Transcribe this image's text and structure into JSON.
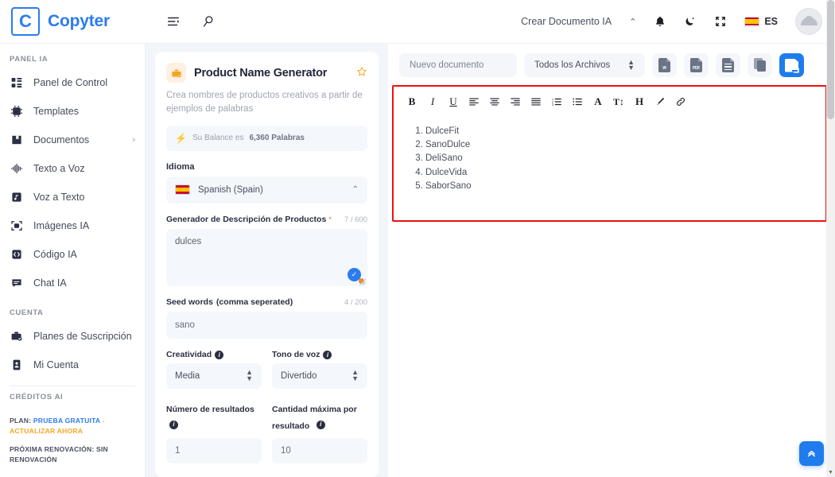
{
  "brand": {
    "logo_letter": "C",
    "name": "Copyter"
  },
  "topbar": {
    "menu_icon": "list-settings-icon",
    "search_icon": "search-icon",
    "create_doc_label": "Crear Documento IA",
    "chevron": "⌃",
    "bell_icon": "bell-icon",
    "theme_icon": "moon-icon",
    "fullscreen_icon": "compress-icon",
    "lang_code": "ES",
    "avatar_icon": "user-avatar"
  },
  "sidebar": {
    "section_panel_label": "PANEL IA",
    "items": [
      {
        "label": "Panel de Control",
        "icon": "dashboard-icon"
      },
      {
        "label": "Templates",
        "icon": "ai-chip-icon"
      },
      {
        "label": "Documentos",
        "icon": "documents-icon",
        "chevron": "›"
      },
      {
        "label": "Texto a Voz",
        "icon": "waveform-icon"
      },
      {
        "label": "Voz a Texto",
        "icon": "audio-file-icon"
      },
      {
        "label": "Imágenes IA",
        "icon": "image-capture-icon"
      },
      {
        "label": "Código IA",
        "icon": "code-icon"
      },
      {
        "label": "Chat IA",
        "icon": "chat-icon"
      }
    ],
    "section_account_label": "CUENTA",
    "account_items": [
      {
        "label": "Planes de Suscripción",
        "icon": "subscription-icon"
      },
      {
        "label": "Mi Cuenta",
        "icon": "account-card-icon"
      }
    ],
    "section_credits_label": "CRÉDITOS AI",
    "plan_prefix": "PLAN:",
    "plan_value": "PRUEBA GRATUITA",
    "plan_dash": "-",
    "plan_upgrade": "ACTUALIZAR AHORA",
    "renewal_text": "PRÓXIMA RENOVACIÓN: SIN RENOVACIÓN"
  },
  "form": {
    "template_icon": "toolbox-icon",
    "title": "Product Name Generator",
    "star_icon": "star-icon",
    "description": "Crea nombres de productos creativos a partir de ejemplos de palabras",
    "balance_icon": "bolt-icon",
    "balance_prefix": "Su Balance es",
    "balance_value": "6,360 Palabras",
    "language_label": "Idioma",
    "language_value": "Spanish (Spain)",
    "language_chevron": "⌃",
    "prompt_label": "Generador de Descripción de Productos",
    "prompt_required": "*",
    "prompt_counter": "7 / 600",
    "prompt_value": "dulces",
    "grammar_icon": "grammarly-check-icon",
    "seed_label": "Seed words",
    "seed_label_muted": "(comma seperated)",
    "seed_counter": "4 / 200",
    "seed_value": "sano",
    "creativity_label": "Creatividad",
    "creativity_value": "Media",
    "tone_label": "Tono de voz",
    "tone_value": "Divertido",
    "results_label": "Número de resultados",
    "results_value": "1",
    "maxlen_label": "Cantidad máxima por resultado",
    "maxlen_value": "10",
    "info_icon": "info-icon"
  },
  "editor": {
    "doc_name_placeholder": "Nuevo documento",
    "filter_value": "Todos los Archivos",
    "export_buttons": [
      {
        "icon": "word-export-icon",
        "tag": "W"
      },
      {
        "icon": "pdf-export-icon",
        "tag": "PDF"
      },
      {
        "icon": "text-export-icon",
        "tag": ""
      },
      {
        "icon": "copy-icon",
        "tag": ""
      },
      {
        "icon": "save-document-icon",
        "tag": ""
      }
    ],
    "format_buttons": [
      {
        "icon": "bold-icon",
        "glyph": "B"
      },
      {
        "icon": "italic-icon",
        "glyph": "I"
      },
      {
        "icon": "underline-icon",
        "glyph": "U"
      },
      {
        "icon": "align-left-icon",
        "glyph": ""
      },
      {
        "icon": "align-center-icon",
        "glyph": ""
      },
      {
        "icon": "align-right-icon",
        "glyph": ""
      },
      {
        "icon": "align-justify-icon",
        "glyph": ""
      },
      {
        "icon": "ordered-list-icon",
        "glyph": ""
      },
      {
        "icon": "unordered-list-icon",
        "glyph": ""
      },
      {
        "icon": "font-color-icon",
        "glyph": "A"
      },
      {
        "icon": "font-size-icon",
        "glyph": "T↕"
      },
      {
        "icon": "heading-icon",
        "glyph": "H"
      },
      {
        "icon": "highlighter-icon",
        "glyph": ""
      },
      {
        "icon": "link-icon",
        "glyph": ""
      }
    ],
    "document_list": [
      "DulceFit",
      "SanoDulce",
      "DeliSano",
      "DulceVida",
      "SaborSano"
    ],
    "scroll_top_icon": "double-chevron-up-icon"
  },
  "colors": {
    "accent_blue": "#2b7cf0",
    "button_blue": "#1f7ced",
    "annotation_red": "#ee1111",
    "orange": "#f5a623",
    "panel_bg": "#f2f5f9"
  }
}
